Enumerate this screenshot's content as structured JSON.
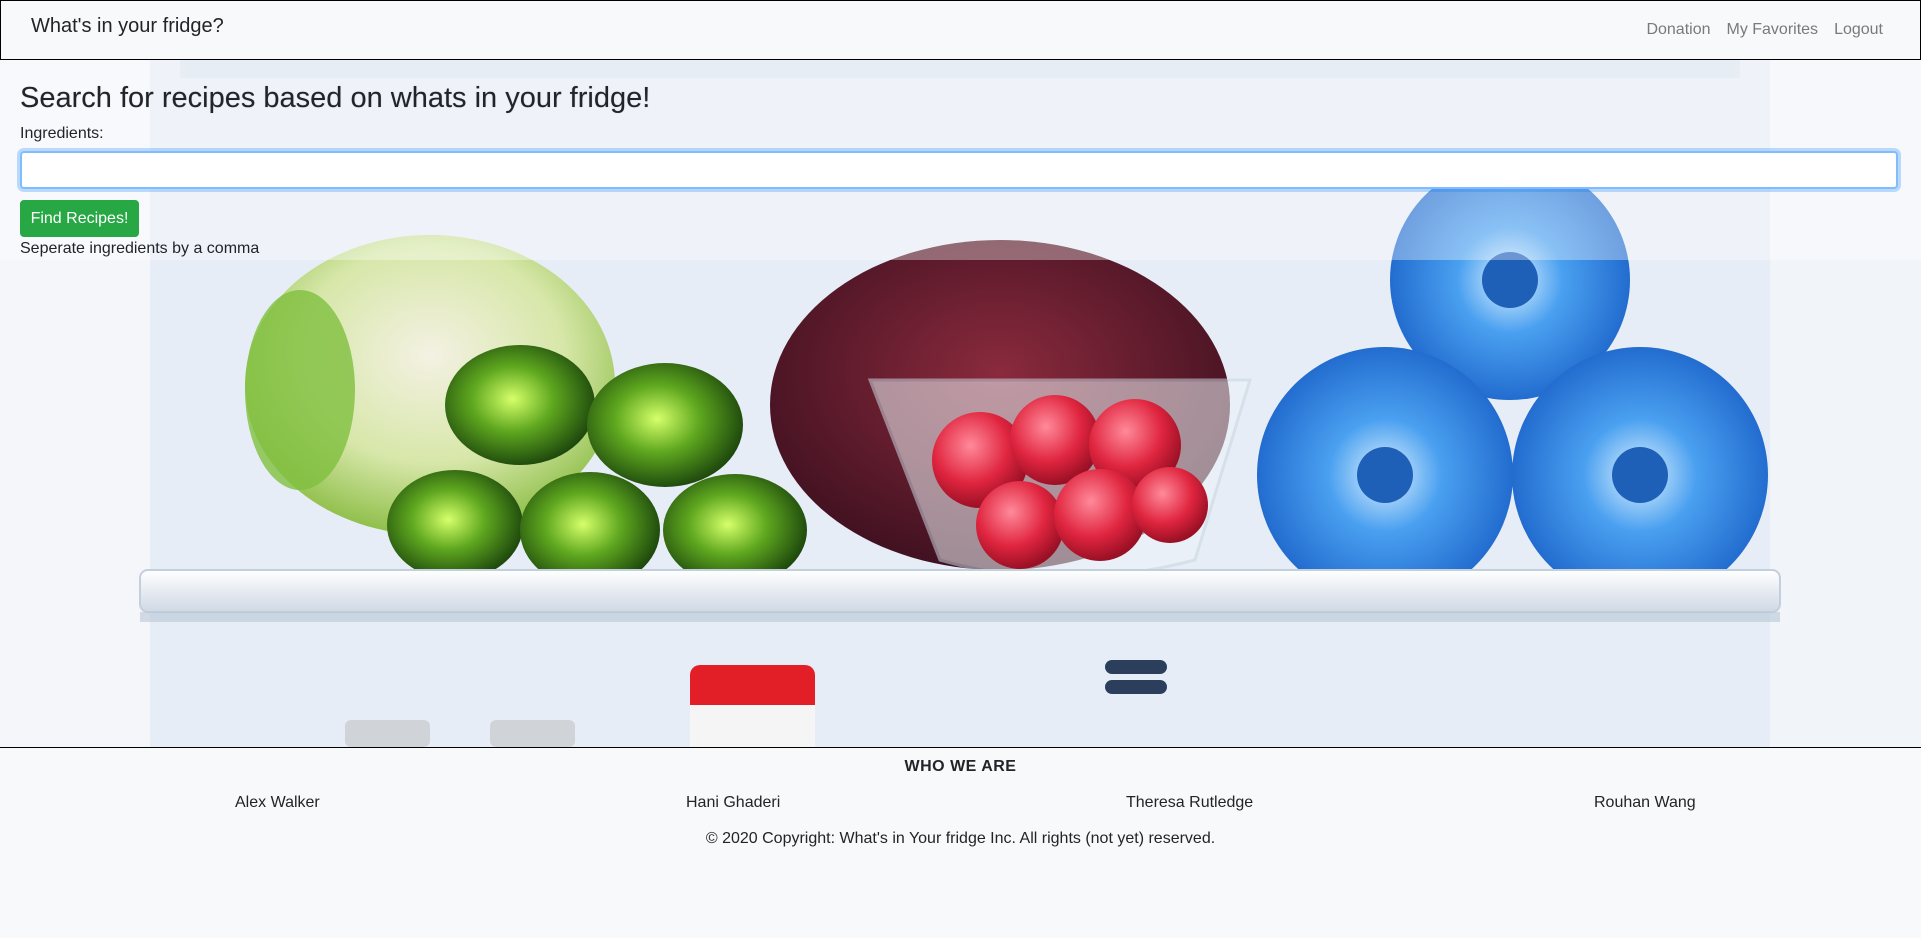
{
  "navbar": {
    "brand": "What's in your fridge?",
    "links": [
      "Donation",
      "My Favorites",
      "Logout"
    ]
  },
  "search": {
    "title": "Search for recipes based on whats in your fridge!",
    "ingredients_label": "Ingredients:",
    "input_value": "",
    "button_label": "Find Recipes!",
    "hint": "Seperate ingredients by a comma"
  },
  "footer": {
    "heading": "WHO WE ARE",
    "members": [
      "Alex Walker",
      "Hani Ghaderi",
      "Theresa Rutledge",
      "Rouhan Wang"
    ],
    "copyright": "© 2020 Copyright: What's in Your fridge Inc. All rights (not yet) reserved."
  },
  "colors": {
    "accent_button": "#28a745",
    "focus_border": "#80bdff",
    "nav_link": "#7a7a7a"
  }
}
